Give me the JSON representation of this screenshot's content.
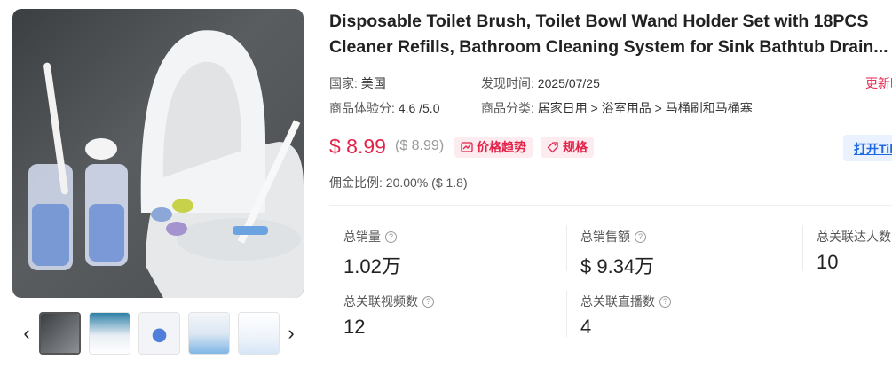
{
  "product": {
    "title_line1": "Disposable Toilet Brush, Toilet Bowl Wand Holder Set with 18PCS",
    "title_line2": "Cleaner Refills, Bathroom Cleaning System for Sink Bathtub Drain..."
  },
  "meta": {
    "country_label": "国家:",
    "country_value": "美国",
    "discover_label": "发现时间:",
    "discover_value": "2025/07/25",
    "update_label": "更新时",
    "rating_label": "商品体验分:",
    "rating_value": "4.6 /5.0",
    "category_label": "商品分类:",
    "category_path": "居家日用 > 浴室用品 > 马桶刷和马桶塞"
  },
  "price": {
    "current": "$ 8.99",
    "original": "($ 8.99)",
    "trend_label": "价格趋势",
    "spec_label": "规格",
    "open_label": "打开Tik"
  },
  "commission": {
    "label": "佣金比例:",
    "value": "20.00% ($ 1.8)"
  },
  "stats": [
    {
      "label": "总销量",
      "value": "1.02万"
    },
    {
      "label": "总销售额",
      "value": "$ 9.34万"
    },
    {
      "label": "总关联达人数",
      "value": "10"
    },
    {
      "label": "总关联视频数",
      "value": "12"
    },
    {
      "label": "总关联直播数",
      "value": "4"
    }
  ],
  "colors": {
    "accent_red": "#e3224a",
    "link_blue": "#1f6ae0"
  },
  "icons": {
    "prev": "chevron-left-icon",
    "next": "chevron-right-icon",
    "help": "question-circle-icon",
    "trend": "chart-icon",
    "spec": "tag-icon"
  }
}
